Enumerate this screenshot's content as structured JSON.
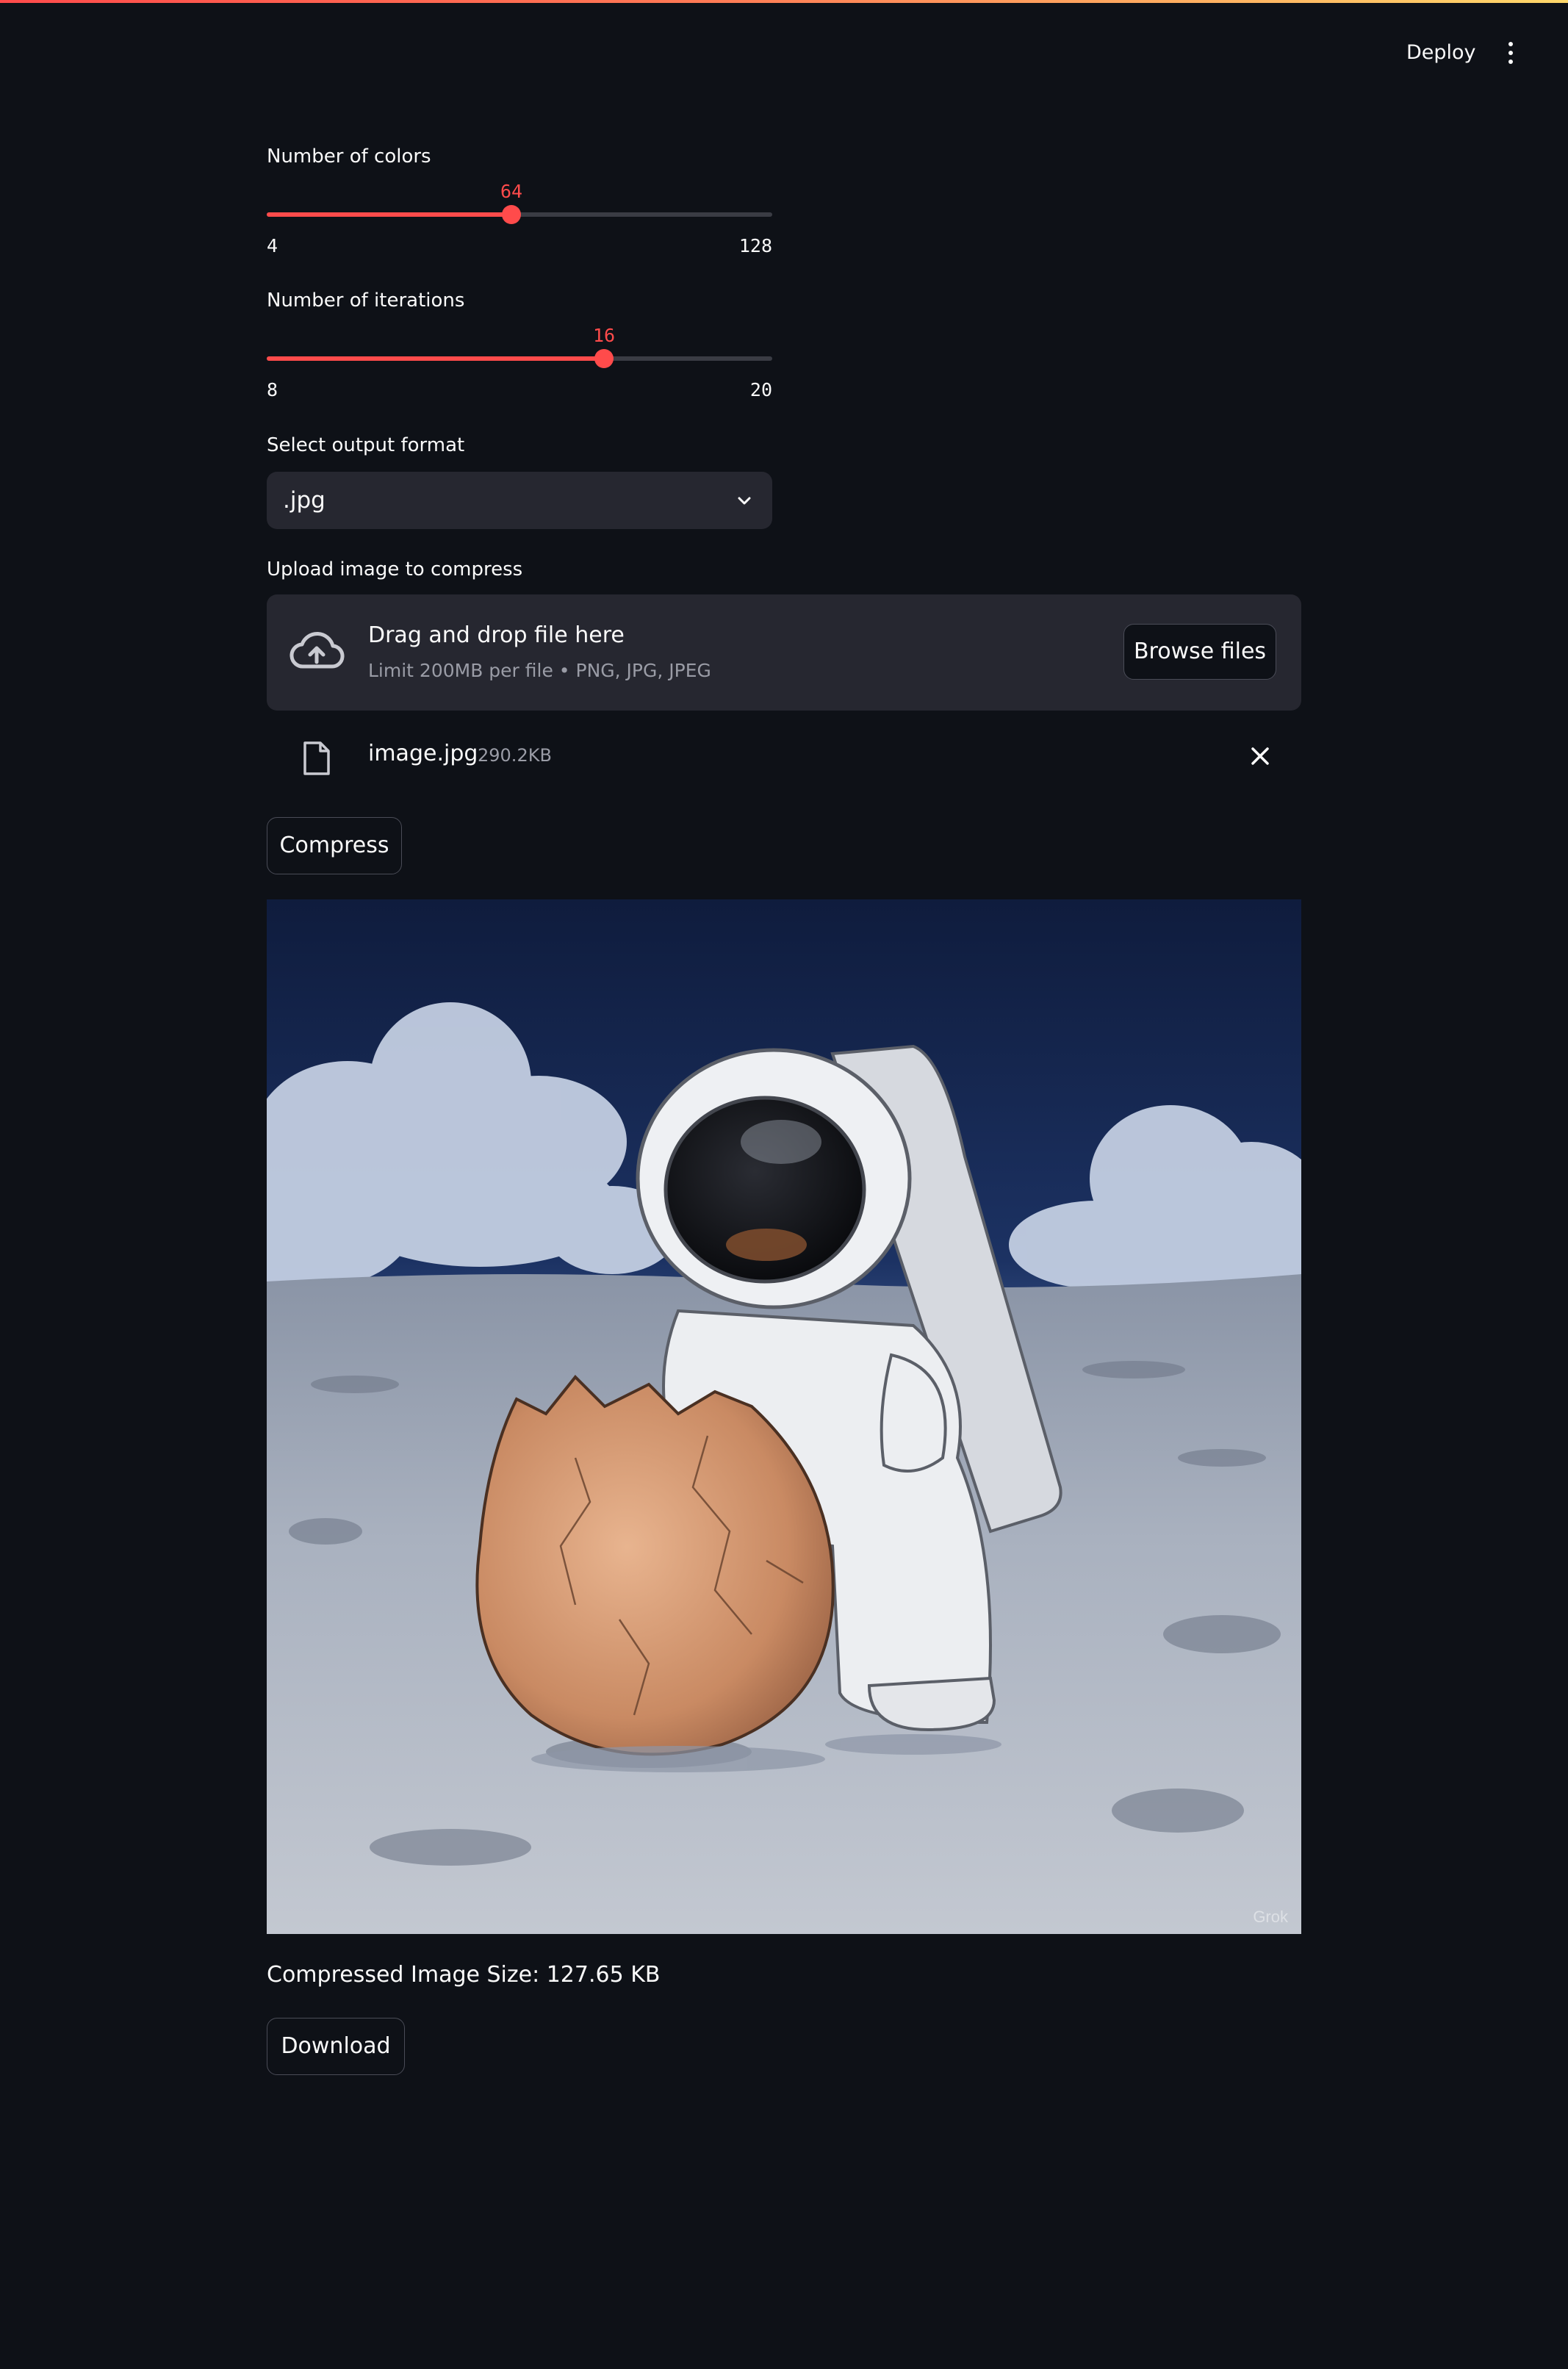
{
  "header": {
    "deploy_label": "Deploy"
  },
  "colors_slider": {
    "label": "Number of colors",
    "value": 64,
    "min": 4,
    "max": 128
  },
  "iterations_slider": {
    "label": "Number of iterations",
    "value": 16,
    "min": 8,
    "max": 20
  },
  "format_select": {
    "label": "Select output format",
    "value": ".jpg"
  },
  "uploader": {
    "label": "Upload image to compress",
    "dropzone_title": "Drag and drop file here",
    "dropzone_subtitle": "Limit 200MB per file • PNG, JPG, JPEG",
    "browse_label": "Browse files"
  },
  "uploaded_file": {
    "name": "image.jpg",
    "size": "290.2KB"
  },
  "compress_button": {
    "label": "Compress"
  },
  "output": {
    "image_watermark": "Grok",
    "size_text": "Compressed Image Size: 127.65 KB",
    "download_label": "Download"
  },
  "theme": {
    "accent": "#ff4b4b",
    "background": "#0e1117",
    "surface": "#262730"
  }
}
